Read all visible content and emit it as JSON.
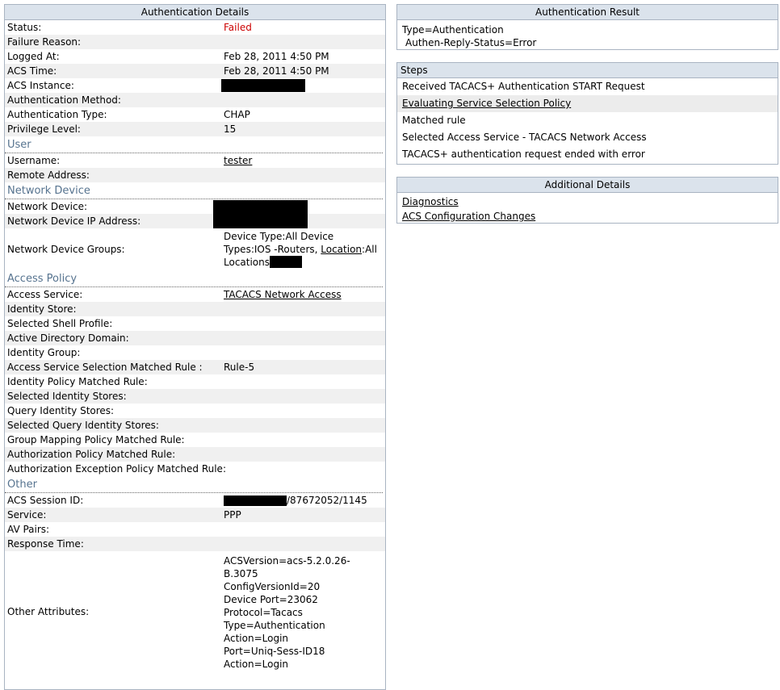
{
  "details": {
    "title": "Authentication Details",
    "rows_top": [
      {
        "label": "Status:",
        "value": "Failed"
      },
      {
        "label": "Failure Reason:",
        "value": ""
      },
      {
        "label": "Logged At:",
        "value": "Feb 28, 2011 4:50 PM"
      },
      {
        "label": "ACS Time:",
        "value": "Feb 28, 2011 4:50 PM"
      },
      {
        "label": "ACS Instance:",
        "value": ""
      },
      {
        "label": "Authentication Method:",
        "value": ""
      },
      {
        "label": "Authentication Type:",
        "value": "CHAP"
      },
      {
        "label": "Privilege Level:",
        "value": "15"
      }
    ],
    "user_section": "User",
    "username_label": "Username:",
    "username_value": "tester",
    "remote_label": "Remote Address:",
    "device_section": "Network Device",
    "device_label": "Network Device:",
    "device_ip_label": "Network Device IP Address:",
    "device_groups_label": "Network Device Groups:",
    "device_groups_text1": "Device Type:All Device Types:IOS -Routers, ",
    "device_groups_link": "Location",
    "device_groups_text2": ":All Locations",
    "policy_section": "Access Policy",
    "access_service_label": "Access Service:",
    "access_service_value": "TACACS Network Access",
    "policy_rows": [
      {
        "label": "Identity Store:",
        "value": ""
      },
      {
        "label": "Selected Shell Profile:",
        "value": ""
      },
      {
        "label": "Active Directory Domain:",
        "value": ""
      },
      {
        "label": "Identity Group:",
        "value": ""
      },
      {
        "label": "Access Service Selection Matched Rule :",
        "value": "Rule-5"
      },
      {
        "label": "Identity Policy Matched Rule:",
        "value": ""
      },
      {
        "label": "Selected Identity Stores:",
        "value": ""
      },
      {
        "label": "Query Identity Stores:",
        "value": ""
      },
      {
        "label": "Selected Query Identity Stores:",
        "value": ""
      },
      {
        "label": "Group Mapping Policy Matched Rule:",
        "value": ""
      },
      {
        "label": "Authorization Policy Matched Rule:",
        "value": ""
      },
      {
        "label": "Authorization Exception Policy Matched Rule:",
        "value": ""
      }
    ],
    "other_section": "Other",
    "session_label": "ACS Session ID:",
    "session_suffix": "/87672052/1145",
    "other_rows": [
      {
        "label": "Service:",
        "value": "PPP"
      },
      {
        "label": "AV Pairs:",
        "value": ""
      },
      {
        "label": "Response Time:",
        "value": ""
      }
    ],
    "other_attrs_label": "Other Attributes:",
    "other_attrs_lines": [
      "ACSVersion=acs-5.2.0.26-",
      "B.3075",
      "ConfigVersionId=20",
      "Device Port=23062",
      "Protocol=Tacacs",
      "Type=Authentication",
      "Action=Login",
      "Port=Uniq-Sess-ID18",
      "Action=Login"
    ]
  },
  "result": {
    "title": "Authentication Result",
    "line1": "Type=Authentication",
    "line2": "Authen-Reply-Status=Error"
  },
  "steps": {
    "title": "Steps",
    "items": [
      "Received TACACS+ Authentication START Request",
      "Evaluating Service Selection Policy",
      "Matched rule",
      "Selected Access Service - TACACS Network Access",
      "TACACS+ authentication request ended with error"
    ]
  },
  "additional": {
    "title": "Additional Details",
    "link1": "Diagnostics",
    "link2": "ACS Configuration Changes"
  },
  "colors": {
    "failed": "#cc0000",
    "section_heading": "#56738f",
    "panel_header_bg": "#dbe3ec"
  }
}
